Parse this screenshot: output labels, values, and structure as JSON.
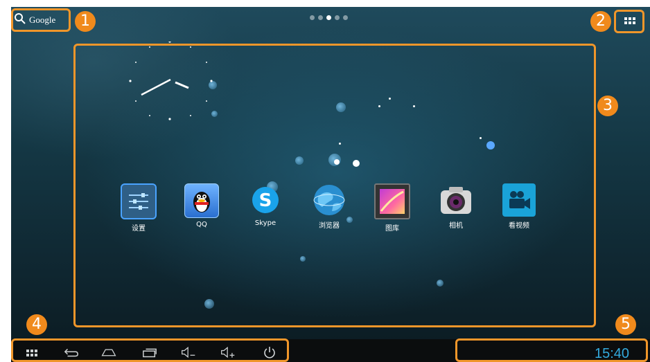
{
  "search": {
    "label": "Google"
  },
  "home": {
    "pages": 5,
    "active_page": 3
  },
  "apps": [
    {
      "label": "设置",
      "icon": "settings-icon"
    },
    {
      "label": "QQ",
      "icon": "qq-penguin-icon"
    },
    {
      "label": "Skype",
      "icon": "skype-icon"
    },
    {
      "label": "浏览器",
      "icon": "browser-globe-icon"
    },
    {
      "label": "图库",
      "icon": "gallery-icon"
    },
    {
      "label": "相机",
      "icon": "camera-icon"
    },
    {
      "label": "看视频",
      "icon": "video-icon"
    }
  ],
  "navbar": {
    "buttons": [
      "apps-grid-icon",
      "back-icon",
      "home-icon",
      "recents-icon",
      "volume-down-icon",
      "volume-up-icon",
      "power-icon"
    ]
  },
  "status": {
    "time": "15:40"
  },
  "callouts": [
    "1",
    "2",
    "3",
    "4",
    "5"
  ],
  "colors": {
    "callout": "#f0962a",
    "time": "#33aadd"
  }
}
